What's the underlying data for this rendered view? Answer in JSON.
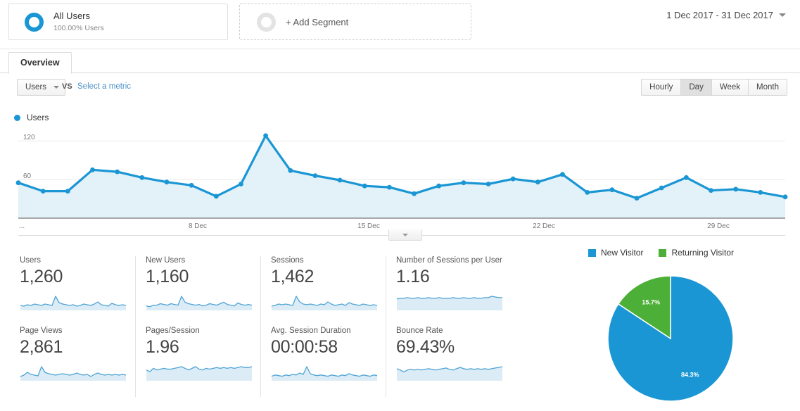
{
  "segments": {
    "all_users": {
      "title": "All Users",
      "sub": "100.00% Users"
    },
    "add_segment": {
      "label": "+ Add Segment"
    }
  },
  "date_range": {
    "label": "1 Dec 2017 - 31 Dec 2017"
  },
  "tabs": [
    {
      "label": "Overview",
      "active": true
    }
  ],
  "metric_selector": {
    "selected": "Users",
    "vs_label": "VS",
    "compare_link": "Select a metric"
  },
  "granularity": {
    "options": [
      "Hourly",
      "Day",
      "Week",
      "Month"
    ],
    "selected": "Day"
  },
  "colors": {
    "blue": "#1a96d4",
    "green": "#4caf37",
    "area_fill": "#e3f1f8",
    "link": "#4d90c9"
  },
  "chart_data": {
    "type": "line",
    "title": "Users",
    "xlabel": "",
    "ylabel": "Users",
    "legend": [
      "Users"
    ],
    "legend_position": "top-left",
    "grid": true,
    "ylim": [
      0,
      130
    ],
    "yticks": [
      60,
      120
    ],
    "ytick_labels": [
      "60",
      "120"
    ],
    "xtick_labels": [
      "...",
      "8 Dec",
      "15 Dec",
      "22 Dec",
      "29 Dec"
    ],
    "x": [
      "1 Dec",
      "2 Dec",
      "3 Dec",
      "4 Dec",
      "5 Dec",
      "6 Dec",
      "7 Dec",
      "8 Dec",
      "9 Dec",
      "10 Dec",
      "11 Dec",
      "12 Dec",
      "13 Dec",
      "14 Dec",
      "15 Dec",
      "16 Dec",
      "17 Dec",
      "18 Dec",
      "19 Dec",
      "20 Dec",
      "21 Dec",
      "22 Dec",
      "23 Dec",
      "24 Dec",
      "25 Dec",
      "26 Dec",
      "27 Dec",
      "28 Dec",
      "29 Dec",
      "30 Dec",
      "31 Dec"
    ],
    "series": [
      {
        "name": "Users",
        "values": [
          55,
          42,
          42,
          75,
          72,
          63,
          56,
          51,
          34,
          53,
          128,
          74,
          66,
          59,
          50,
          48,
          38,
          50,
          55,
          53,
          61,
          56,
          68,
          40,
          44,
          31,
          47,
          63,
          43,
          45,
          40,
          33
        ]
      }
    ]
  },
  "metric_cards": [
    {
      "label": "Users",
      "value": "1,260",
      "spark": [
        7,
        6,
        8,
        7,
        9,
        8,
        7,
        9,
        8,
        7,
        20,
        11,
        9,
        8,
        7,
        8,
        6,
        7,
        9,
        8,
        7,
        9,
        12,
        8,
        7,
        6,
        10,
        8,
        7,
        8,
        7
      ]
    },
    {
      "label": "New Users",
      "value": "1,160",
      "spark": [
        6,
        5,
        7,
        7,
        9,
        8,
        7,
        9,
        8,
        7,
        19,
        11,
        9,
        8,
        7,
        8,
        6,
        7,
        9,
        8,
        7,
        9,
        11,
        8,
        7,
        6,
        10,
        8,
        7,
        8,
        7
      ]
    },
    {
      "label": "Sessions",
      "value": "1,462",
      "spark": [
        6,
        7,
        9,
        8,
        9,
        8,
        7,
        20,
        12,
        9,
        8,
        9,
        8,
        7,
        9,
        8,
        12,
        9,
        7,
        8,
        9,
        7,
        11,
        9,
        8,
        7,
        9,
        8,
        7,
        8,
        7
      ]
    },
    {
      "label": "Number of Sessions per User",
      "value": "1.16",
      "spark": [
        17,
        18,
        18,
        19,
        18,
        18,
        19,
        18,
        18,
        19,
        18,
        18,
        19,
        18,
        18,
        18,
        19,
        18,
        18,
        19,
        18,
        18,
        19,
        18,
        18,
        19,
        19,
        21,
        20,
        19,
        19
      ]
    },
    {
      "label": "Page Views",
      "value": "2,861",
      "spark": [
        6,
        8,
        12,
        9,
        8,
        7,
        20,
        12,
        10,
        9,
        8,
        9,
        10,
        9,
        8,
        9,
        11,
        9,
        8,
        9,
        6,
        9,
        11,
        9,
        8,
        9,
        8,
        9,
        8,
        9,
        8
      ]
    },
    {
      "label": "Pages/Session",
      "value": "1.96",
      "spark": [
        13,
        11,
        15,
        13,
        14,
        15,
        14,
        14,
        15,
        16,
        17,
        15,
        13,
        15,
        17,
        14,
        13,
        15,
        14,
        15,
        16,
        15,
        16,
        15,
        16,
        15,
        16,
        17,
        16,
        16,
        17
      ]
    },
    {
      "label": "Avg. Session Duration",
      "value": "00:00:58",
      "spark": [
        7,
        9,
        8,
        7,
        9,
        8,
        10,
        9,
        12,
        10,
        22,
        11,
        9,
        8,
        9,
        8,
        7,
        9,
        8,
        7,
        9,
        8,
        11,
        9,
        8,
        7,
        9,
        8,
        7,
        9,
        8
      ]
    },
    {
      "label": "Bounce Rate",
      "value": "69.43%",
      "spark": [
        18,
        16,
        13,
        16,
        17,
        16,
        17,
        16,
        17,
        18,
        17,
        16,
        17,
        18,
        19,
        17,
        16,
        18,
        20,
        18,
        17,
        18,
        17,
        18,
        17,
        18,
        17,
        18,
        19,
        20,
        21
      ]
    }
  ],
  "pie_chart": {
    "type": "pie",
    "title": "",
    "legend": [
      "New Visitor",
      "Returning Visitor"
    ],
    "legend_position": "top",
    "labels": [
      "New Visitor",
      "Returning Visitor"
    ],
    "values": [
      84.3,
      15.7
    ],
    "value_labels": [
      "84.3%",
      "15.7%"
    ],
    "colors": [
      "#1a96d4",
      "#4caf37"
    ]
  }
}
